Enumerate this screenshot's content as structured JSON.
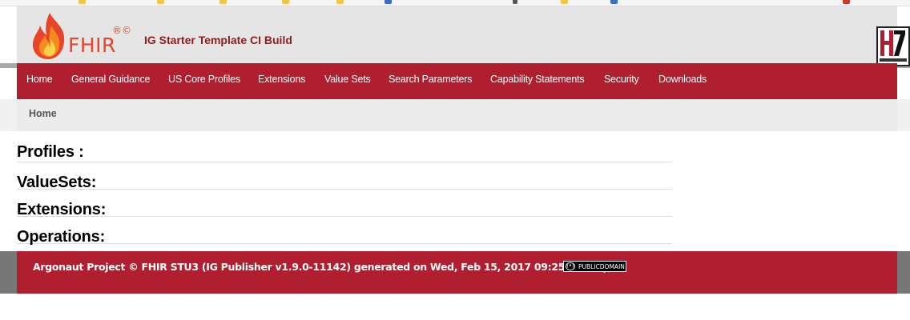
{
  "header": {
    "logo_text": "FHIR",
    "logo_marks": "®©",
    "site_title": "IG Starter Template CI Build"
  },
  "colors": {
    "brand_red": "#b01f2f",
    "title_red": "#8c1d1d",
    "logo_orange": "#e7442b"
  },
  "nav": {
    "items": [
      {
        "label": "Home"
      },
      {
        "label": "General Guidance"
      },
      {
        "label": "US Core Profiles"
      },
      {
        "label": "Extensions"
      },
      {
        "label": "Value Sets"
      },
      {
        "label": "Search Parameters"
      },
      {
        "label": "Capability Statements"
      },
      {
        "label": "Security"
      },
      {
        "label": "Downloads"
      }
    ]
  },
  "breadcrumb": {
    "home": "Home"
  },
  "content": {
    "sections": [
      {
        "heading": "Profiles :"
      },
      {
        "heading": "ValueSets:"
      },
      {
        "heading": "Extensions:"
      },
      {
        "heading": "Operations:"
      }
    ]
  },
  "footer": {
    "text": "Argonaut Project © FHIR STU3 (IG Publisher v1.9.0-11142) generated on Wed, Feb 15, 2017 09:25-0800. |",
    "badge_label": "PUBLICDOMAIN",
    "badge_symbol": "(•)"
  }
}
